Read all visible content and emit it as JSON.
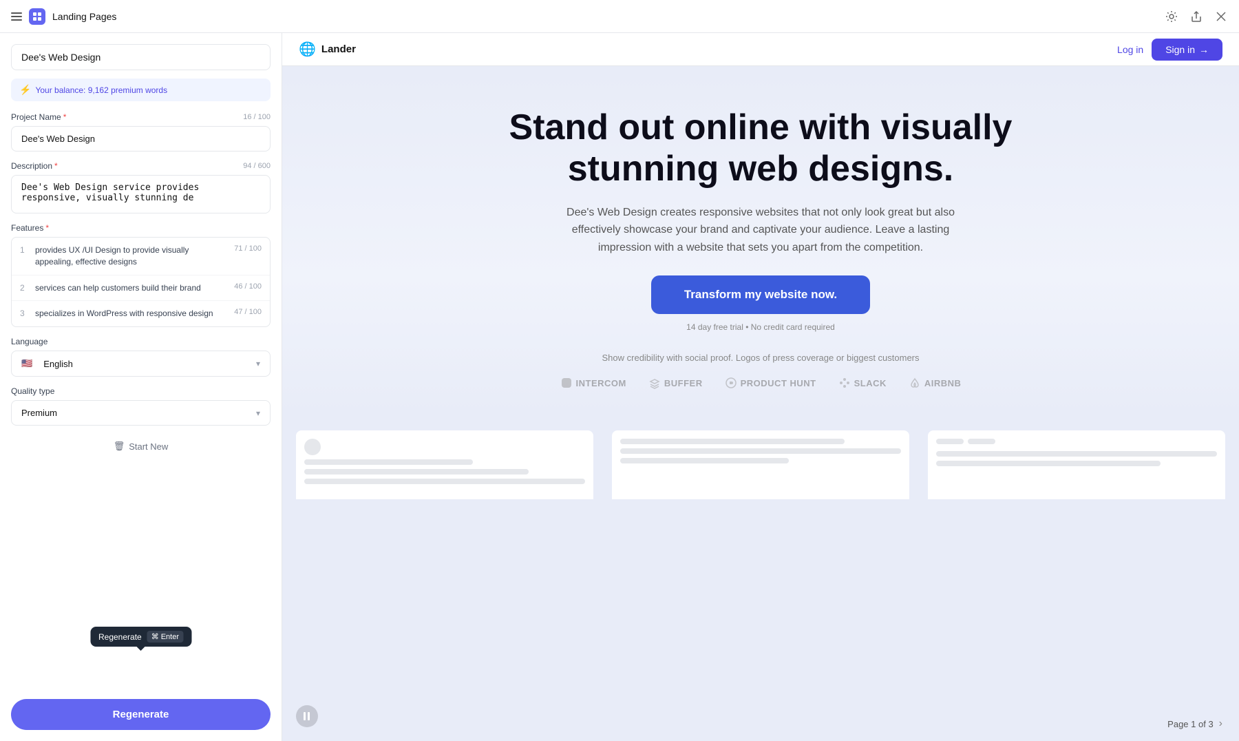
{
  "titlebar": {
    "app_name": "Landing Pages",
    "settings_icon": "⚙",
    "share_icon": "⬆",
    "close_icon": "✕"
  },
  "left_panel": {
    "project_header": "Dee's Web Design",
    "balance": {
      "icon": "⚡",
      "text": "Your balance: 9,162 premium words"
    },
    "project_name": {
      "label": "Project Name",
      "required": true,
      "char_count": "16 / 100",
      "value": "Dee's Web Design"
    },
    "description": {
      "label": "Description",
      "required": true,
      "char_count": "94 / 600",
      "value": "Dee's Web Design service provides responsive, visually stunning de"
    },
    "features": {
      "label": "Features",
      "required": true,
      "items": [
        {
          "num": "1",
          "text": "provides UX /UI Design to provide visually appealing, effective designs",
          "count": "71 / 100"
        },
        {
          "num": "2",
          "text": "services can help customers build their brand",
          "count": "46 / 100"
        },
        {
          "num": "3",
          "text": "specializes in WordPress with responsive design",
          "count": "47 / 100"
        }
      ]
    },
    "language": {
      "label": "Language",
      "value": "English",
      "flag": "🇺🇸"
    },
    "quality_type": {
      "label": "Quality type",
      "value": "Premium"
    },
    "start_new_label": "Start New",
    "regenerate_button": "Regenerate",
    "tooltip": {
      "label": "Regenerate",
      "shortcut_icon": "⌘",
      "shortcut_key": "Enter"
    }
  },
  "preview": {
    "brand": "Lander",
    "login_label": "Log in",
    "signin_label": "Sign in",
    "hero": {
      "title": "Stand out online with visually stunning web designs.",
      "subtitle": "Dee's Web Design creates responsive websites that not only look great but also effectively showcase your brand and captivate your audience. Leave a lasting impression with a website that sets you apart from the competition.",
      "cta": "Transform my website now.",
      "disclaimer": "14 day free trial • No credit card required",
      "social_proof_label": "Show credibility with social proof. Logos of press coverage or biggest customers",
      "logos": [
        {
          "icon": "▦",
          "name": "INTERCOM"
        },
        {
          "icon": "◈",
          "name": "Buffer"
        },
        {
          "icon": "◉",
          "name": "Product Hunt"
        },
        {
          "icon": "✦",
          "name": "slack"
        },
        {
          "icon": "◇",
          "name": "airbnb"
        }
      ]
    },
    "page_indicator": {
      "current": "Page 1 of 3"
    }
  }
}
